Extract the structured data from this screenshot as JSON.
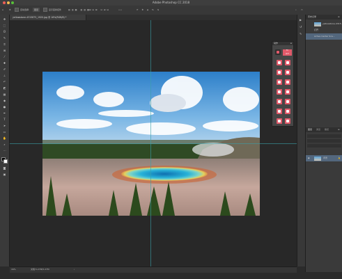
{
  "app": {
    "title": "Adobe Photoshop CC 2018"
  },
  "options_bar": {
    "home_icon": "home-icon",
    "tool_icon": "move-tool-icon",
    "auto_select_label": "自动选择:",
    "layer_select": "图层",
    "transform_label": "显示变换控件",
    "more_icon": "ellipsis-icon"
  },
  "document": {
    "tab_label": "yellowstone-4315875_1920.jpg @ 16%(RGB/8) *",
    "image_description": "Grand Prismatic Spring, Yellowstone"
  },
  "status": {
    "zoom": "16%",
    "doc_info": "文档:5.27M/5.27M"
  },
  "history_panel": {
    "tabs": [
      "历史记录"
    ],
    "items": [
      {
        "label": "yellowstone-4315..."
      },
      {
        "label": "打开"
      },
      {
        "label": "Active Center Sca..."
      }
    ]
  },
  "layers_panel": {
    "tabs": [
      "图层",
      "通道",
      "路径"
    ],
    "items": [
      {
        "label": "背景",
        "locked": true
      }
    ]
  },
  "actions_panel": {
    "header": "动作",
    "button_count": 18
  },
  "colors": {
    "accent": "#53677d",
    "action_button": "#e15a6a",
    "guide": "#3aa0a8",
    "background": "#282828"
  }
}
